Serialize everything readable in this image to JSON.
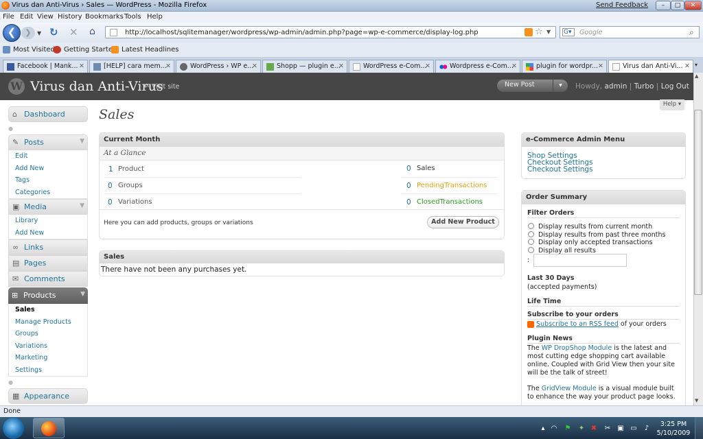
{
  "browser": {
    "window_title": "Virus dan Anti-Virus › Sales — WordPress - Mozilla Firefox",
    "send_feedback": "Send Feedback",
    "menu": [
      "File",
      "Edit",
      "View",
      "History",
      "Bookmarks",
      "Tools",
      "Help"
    ],
    "url": "http://localhost/sqlitemanager/wordpress/wp-admin/admin.php?page=wp-e-commerce/display-log.php",
    "search_placeholder": "Google",
    "bookmarks": [
      "Most Visited",
      "Getting Started",
      "Latest Headlines"
    ],
    "tabs": [
      {
        "label": "Facebook | Mank...",
        "icon_color": "#3b5998"
      },
      {
        "label": "[HELP] cara mem...",
        "icon_color": "#6d8ab0"
      },
      {
        "label": "WordPress › WP e...",
        "icon_color": "#666666"
      },
      {
        "label": "Shopp — plugin e...",
        "icon_color": "#6aa84f"
      },
      {
        "label": "WordPress e-Com...",
        "icon_color": "#cccccc"
      },
      {
        "label": "Wordpress e-Com...",
        "icon_color": "#e33b8e"
      },
      {
        "label": "plugin for wordpr...",
        "icon_color": "#4285f4"
      },
      {
        "label": "Virus dan Anti-Vi...",
        "icon_color": "#cccccc"
      }
    ],
    "status": "Done"
  },
  "wp": {
    "site_name": "Virus dan Anti-Virus",
    "visit_site": "← Visit site",
    "new_post": "New Post",
    "howdy": "Howdy,",
    "user": "admin",
    "turbo": "Turbo",
    "logout": "Log Out",
    "help": "Help"
  },
  "sidebar": {
    "dashboard": "Dashboard",
    "posts": "Posts",
    "posts_sub": [
      "Edit",
      "Add New",
      "Tags",
      "Categories"
    ],
    "media": "Media",
    "media_sub": [
      "Library",
      "Add New"
    ],
    "links": "Links",
    "pages": "Pages",
    "comments": "Comments",
    "products": "Products",
    "products_sub": [
      "Sales",
      "Manage Products",
      "Groups",
      "Variations",
      "Marketing",
      "Settings"
    ],
    "appearance": "Appearance"
  },
  "main": {
    "title": "Sales",
    "current_month": {
      "heading": "Current Month",
      "subheading": "At a Glance",
      "left": [
        {
          "count": "1",
          "label": "Product"
        },
        {
          "count": "0",
          "label": "Groups"
        },
        {
          "count": "0",
          "label": "Variations"
        }
      ],
      "right": [
        {
          "count": "0",
          "label": "Sales",
          "color": "#333333"
        },
        {
          "count": "0",
          "label": "PendingTransactions",
          "color": "#e5a10d"
        },
        {
          "count": "0",
          "label": "ClosedTransactions",
          "color": "#2a9d1f"
        }
      ],
      "footer_text": "Here you can add products, groups or variations",
      "add_button": "Add New Product"
    },
    "sales": {
      "heading": "Sales",
      "empty_text": "There have not been any purchases yet."
    }
  },
  "right": {
    "admin_menu": {
      "heading": "e-Commerce Admin Menu",
      "links": [
        "Shop Settings",
        "Checkout Settings",
        "Checkout Settings"
      ]
    },
    "order_summary": {
      "heading": "Order Summary",
      "filter_heading": "Filter Orders",
      "filters": [
        "Display results from current month",
        "Display results from past three months",
        "Display only accepted transactions",
        "Display all results"
      ],
      "filter_input_label": ":",
      "last30": "Last 30 Days",
      "last30_sub": "(accepted payments)",
      "lifetime": "Life Time",
      "subscribe_heading": "Subscribe to your orders",
      "subscribe_link": "Subscribe to an RSS feed",
      "subscribe_rest": " of your orders",
      "plugin_news": "Plugin News",
      "news1_pre": "The ",
      "news1_link": "WP DropShop Module",
      "news1_post": " is the latest and most cutting edge shopping cart available online. Coupled with Grid View then your site will be the talk of street!",
      "news2_pre": "The ",
      "news2_link": "GridView Module",
      "news2_post": " is a visual module built to enhance the way your product page looks."
    }
  },
  "taskbar": {
    "time": "3:25 PM",
    "date": "5/10/2009"
  }
}
